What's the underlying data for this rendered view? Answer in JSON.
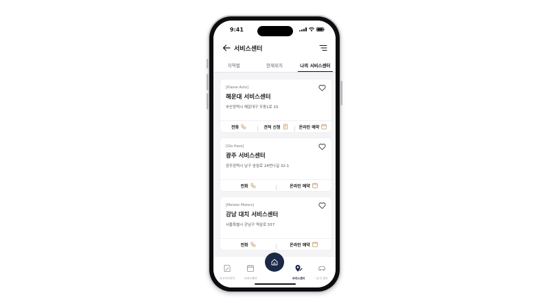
{
  "status": {
    "time": "9:41"
  },
  "header": {
    "title": "서비스센터"
  },
  "tabs": [
    {
      "label": "지역별"
    },
    {
      "label": "현재위치"
    },
    {
      "label": "나의 서비스센터"
    }
  ],
  "cards": [
    {
      "brand": "[Klasse Auto]",
      "name": "해운대 서비스센터",
      "address": "부산광역시 해운대구 우동1로 15",
      "actions": [
        {
          "label": "전화"
        },
        {
          "label": "견적 신청"
        },
        {
          "label": "온라인 예약"
        }
      ]
    },
    {
      "brand": "[Glo Haus]",
      "name": "광주 서비스센터",
      "address": "광주광역시 남구 송암로 24번나길 32-1",
      "actions": [
        {
          "label": "전화"
        },
        {
          "label": "온라인 예약"
        }
      ]
    },
    {
      "brand": "[Meister Motors]",
      "name": "강남 대치 서비스센터",
      "address": "서울특별시 강남구 역삼로 557",
      "actions": [
        {
          "label": "전화"
        },
        {
          "label": "온라인 예약"
        }
      ]
    }
  ],
  "nav": [
    {
      "label": "사고수리견적",
      "icon": "note-icon"
    },
    {
      "label": "서비스예약",
      "icon": "calendar-icon"
    },
    {
      "label": "",
      "icon": "home-icon"
    },
    {
      "label": "서비스센터",
      "icon": "location-pin-icon"
    },
    {
      "label": "내 차 정보",
      "icon": "car-icon"
    }
  ],
  "colors": {
    "navy": "#1c2847",
    "accent": "#b07a3e"
  }
}
